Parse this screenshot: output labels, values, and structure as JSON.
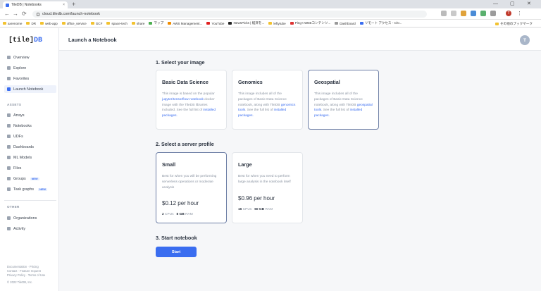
{
  "browser": {
    "tab_title": "TileDB | Notebooks",
    "tab_close": "×",
    "new_tab": "+",
    "window_controls": [
      "—",
      "▢",
      "✕"
    ],
    "nav": [
      "←",
      "→",
      "⟳"
    ],
    "url": "cloud.tiledb.com/launch-notebook",
    "bookmarks": [
      "axrenome",
      "DR",
      "web-app",
      "office_service",
      "GCF",
      "space-tech",
      "share",
      "マップ",
      "AWS Management...",
      "YouTube",
      "NewsPicks | 経済を...",
      "leftytube",
      "Ping-t WEBコンテンツ...",
      "Dashboard",
      "リモート アクセス - Chr...",
      "その他のブックマーク"
    ],
    "profile_initial": "T"
  },
  "sidebar": {
    "logo_left": "[tile]",
    "logo_right": "DB",
    "nav": [
      "Overview",
      "Explore",
      "Favorites",
      "Launch Notebook"
    ],
    "assets_title": "ASSETS",
    "assets": [
      "Arrays",
      "Notebooks",
      "UDFs",
      "Dashboards",
      "ML Models",
      "Files",
      "Groups",
      "Task graphs"
    ],
    "new_badge": "NEW",
    "other_title": "OTHER",
    "other": [
      "Organizations",
      "Activity"
    ],
    "footer": [
      "Documentation",
      "Pricing",
      "Contact",
      "Feature request",
      "Privacy Policy",
      "Terms of Use",
      "© 2022 TileDB, Inc."
    ]
  },
  "header": {
    "title": "Launch a Notebook",
    "avatar": "T"
  },
  "step1": {
    "title": "1. Select your image",
    "cards": [
      {
        "title": "Basic Data Science",
        "d1": "This image is based on the popular ",
        "l1": "jupyter/tensorflow-notebook",
        "d2": " docker image with the TileDB libraries included. See the full list of ",
        "l2": "installed packages."
      },
      {
        "title": "Genomics",
        "d1": "This image includes all of the packages of Basic Data Science notebook, along with TileDB ",
        "l1": "genomics tools",
        "d2": ". See the full list of ",
        "l2": "installed packages."
      },
      {
        "title": "Geospatial",
        "d1": "This image includes all of the packages of Basic Data Science notebook, along with TileDB ",
        "l1": "geospatial tools",
        "d2": ". See the full list of ",
        "l2": "installed packages."
      }
    ]
  },
  "step2": {
    "title": "2. Select a server profile",
    "cards": [
      {
        "title": "Small",
        "desc": "Best for when you will be performing serverless operations or moderate analysis",
        "price": "$0.12 per hour",
        "cpu": "2",
        "cpu_label": "CPUs",
        "ram": "8 GB",
        "ram_label": "RAM"
      },
      {
        "title": "Large",
        "desc": "Best for when you need to perform large analysis in the notebook itself",
        "price": "$0.96 per hour",
        "cpu": "16",
        "cpu_label": "CPUs",
        "ram": "60 GB",
        "ram_label": "RAM"
      }
    ]
  },
  "step3": {
    "title": "3. Start notebook",
    "button": "Start"
  },
  "colors": {
    "accent": "#3a6df0",
    "selected_border": "#6e7fa6"
  }
}
